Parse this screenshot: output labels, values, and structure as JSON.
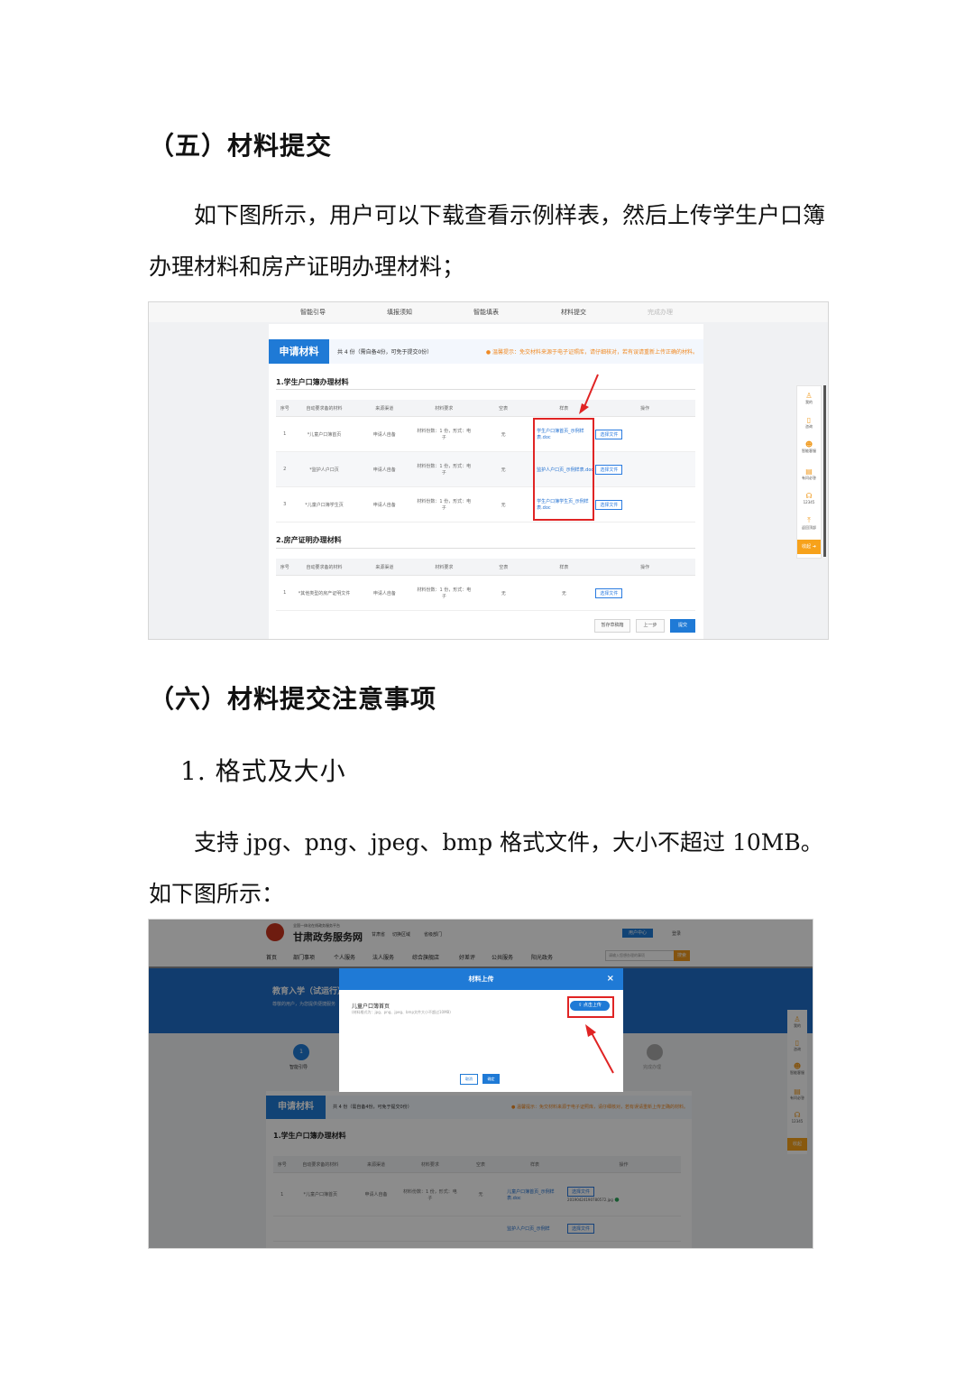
{
  "section5": {
    "heading": "（五）材料提交",
    "paragraph": "如下图所示，用户可以下载查看示例样表，然后上传学生户口簿办理材料和房产证明办理材料；"
  },
  "screenshot1": {
    "steps": [
      "智能引导",
      "填报须知",
      "智能填表",
      "材料提交",
      "完成办理"
    ],
    "banner": {
      "tab": "申请材料",
      "count": "共 4 份（需自备4份，可免于提交0份）",
      "warning": "温馨提示：免交材料来源于电子证照库，请仔细核对，若有误请重新上传正确的材料。"
    },
    "table_headers": [
      "序号",
      "自动要求备的材料",
      "来源渠道",
      "材料要求",
      "空表",
      "样表",
      "操作"
    ],
    "group1": {
      "title": "1.学生户口簿办理材料",
      "rows": [
        {
          "no": "1",
          "name": "*儿童户口簿首页",
          "source": "申请人自备",
          "req": "材料份数：1 份，形式：电子",
          "blank": "无",
          "sample": "学生户口簿首页_示例样表.doc",
          "op": "选择文件"
        },
        {
          "no": "2",
          "name": "*监护人户口页",
          "source": "申请人自备",
          "req": "材料份数：1 份，形式：电子",
          "blank": "无",
          "sample": "监护人户口页_示例样表.doc",
          "op": "选择文件"
        },
        {
          "no": "3",
          "name": "*儿童户口簿学生页",
          "source": "申请人自备",
          "req": "材料份数：1 份，形式：电子",
          "blank": "无",
          "sample": "学生户口簿学生页_示例样表.doc",
          "op": "选择文件"
        }
      ]
    },
    "group2": {
      "title": "2.房产证明办理材料",
      "rows": [
        {
          "no": "1",
          "name": "*其他类型的房产证明文件",
          "source": "申请人自备",
          "req": "材料份数：1 份，形式：电子",
          "blank": "无",
          "sample": "无",
          "op": "选择文件"
        }
      ]
    },
    "footer_buttons": [
      "暂存草稿箱",
      "上一步",
      "提交"
    ],
    "sidebar": [
      "我的",
      "咨询",
      "智能客服",
      "有问必答",
      "12345",
      "返回顶部",
      "收起"
    ]
  },
  "section6": {
    "heading": "（六）材料提交注意事项",
    "sub_heading": "1.  格式及大小",
    "paragraph": "支持 jpg、png、jpeg、bmp 格式文件，大小不超过 10MB。如下图所示："
  },
  "screenshot2": {
    "site_title": "甘肃政务服务网",
    "site_subtitle": "全国一体化在线政务服务平台",
    "region": "甘肃省",
    "header_links": [
      "切换区域",
      "省级部门"
    ],
    "nav": [
      "首页",
      "部门事项",
      "个人服务",
      "法人服务",
      "综合旗舰店",
      "好差评",
      "公共服务",
      "阳光政务"
    ],
    "search_placeholder": "请输入您想办理的事项",
    "search_button": "搜索",
    "header_right": "用户中心",
    "login": "登录",
    "hero_title": "教育入学（试运行）",
    "hero_desc": "尊敬的用户，为您提供便捷服务",
    "step_left": "智能引导",
    "step_right": "完成办理",
    "modal": {
      "title": "材料上传",
      "close": "×",
      "item": "儿童户口簿首页",
      "hint": "(材料格式为：jpg、png、jpeg、bmp文件大小不超过10MB)",
      "upload": "点击上传",
      "cancel": "取消",
      "confirm": "确定"
    },
    "banner": {
      "tab": "申请材料",
      "count": "共 4 份（需自备4份，可免于提交0份）",
      "warning": "温馨提示：免交材料来源于电子证照库，请仔细核对，若有误请重新上传正确的材料。"
    },
    "group_title": "1.学生户口簿办理材料",
    "table_headers": [
      "序号",
      "自动要求备的材料",
      "来源渠道",
      "材料要求",
      "空表",
      "样表",
      "操作"
    ],
    "row": {
      "no": "1",
      "name": "*儿童户口簿首页",
      "source": "申请人自备",
      "req": "材料份数：1 份，形式：电子",
      "blank": "无",
      "sample": "儿童户口簿首页_示例样表.doc",
      "op": "选择文件",
      "file": "20190424190780572.jpg"
    },
    "row2": {
      "op": "选择文件",
      "sample": "监护人户口页_示例样"
    },
    "sidebar": [
      "我的",
      "咨询",
      "智能客服",
      "有问必答",
      "12345",
      "收起"
    ]
  }
}
